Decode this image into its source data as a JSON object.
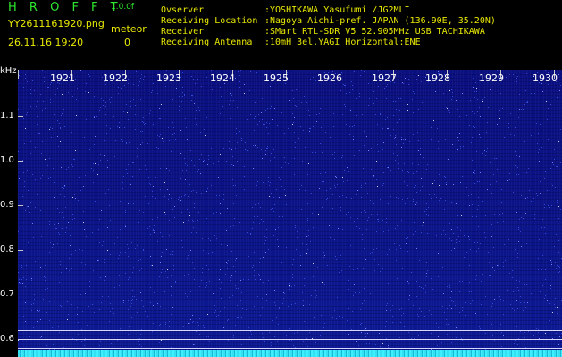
{
  "header": {
    "app_name": "H R O F F T",
    "version": "1.0.0f",
    "filename": "YY2611161920.png",
    "datetime": "26.11.16 19:20",
    "meteor_label": "meteor",
    "meteor_count": "0",
    "observer_label": "Ovserver",
    "observer_value": ":YOSHIKAWA Yasufumi /JG2MLI",
    "location_label": "Receiving Location",
    "location_value": ":Nagoya Aichi-pref. JAPAN (136.90E, 35.20N)",
    "receiver_label": "Receiver",
    "receiver_value": ":SMart RTL-SDR V5 52.905MHz USB TACHIKAWA",
    "antenna_label": "Receiving Antenna",
    "antenna_value": ":10mH 3el.YAGI Horizontal:ENE"
  },
  "axis": {
    "y_unit": "kHz",
    "y_ticks": [
      "1.1",
      "1.0",
      "0.9",
      "0.8",
      "0.7",
      "0.6"
    ],
    "x_ticks": [
      "1921",
      "1922",
      "1923",
      "1924",
      "1925",
      "1926",
      "1927",
      "1928",
      "1929",
      "1930"
    ]
  },
  "colors": {
    "background": "#000000",
    "plot": "#0b1488",
    "header_green": "#2ee62e",
    "header_yellow": "#e8e800",
    "baseline": "#35e0f0"
  }
}
